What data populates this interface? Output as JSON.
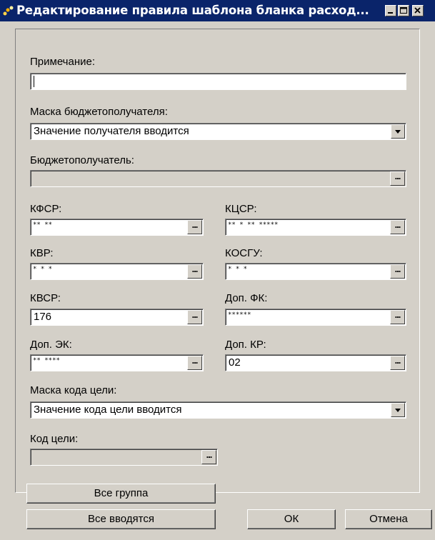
{
  "window": {
    "title": "Редактирование правила шаблона бланка расход...",
    "icon": "app-icon",
    "minimize_icon": "minimize-icon",
    "maximize_icon": "maximize-icon",
    "close_icon": "close-icon"
  },
  "form": {
    "note": {
      "label": "Примечание:",
      "value": ""
    },
    "recipient_mask": {
      "label": "Маска бюджетополучателя:",
      "value": "Значение получателя вводится"
    },
    "recipient": {
      "label": "Бюджетополучатель:",
      "value": ""
    },
    "kfsr": {
      "label": "КФСР:",
      "value": "** **"
    },
    "kcsr": {
      "label": "КЦСР:",
      "value": "** * ** *****"
    },
    "kvr": {
      "label": "КВР:",
      "value": "* * *"
    },
    "kosgu": {
      "label": "КОСГУ:",
      "value": "* * *"
    },
    "kvsr": {
      "label": "КВСР:",
      "value": "176"
    },
    "dop_fk": {
      "label": "Доп. ФК:",
      "value": "******"
    },
    "dop_ek": {
      "label": "Доп. ЭК:",
      "value": "** ****"
    },
    "dop_kr": {
      "label": "Доп. КР:",
      "value": "02"
    },
    "goal_mask": {
      "label": "Маска кода цели:",
      "value": "Значение кода цели вводится"
    },
    "goal_code": {
      "label": "Код цели:",
      "value": ""
    },
    "ellipsis": "..."
  },
  "buttons": {
    "all_group": "Все группа",
    "all_entered": "Все вводятся",
    "ok": "ОК",
    "cancel": "Отмена"
  }
}
